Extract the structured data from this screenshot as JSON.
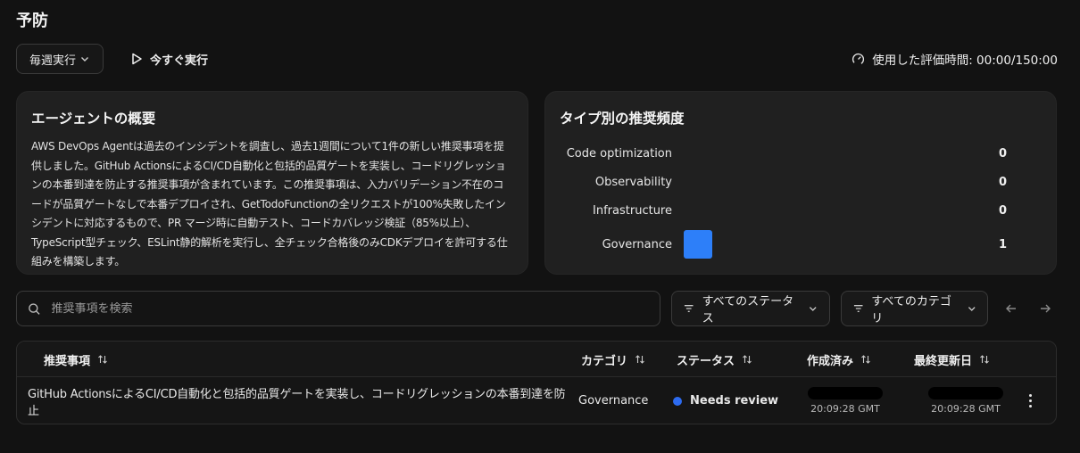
{
  "page": {
    "title": "予防"
  },
  "toolbar": {
    "schedule_label": "毎週実行",
    "run_now_label": "今すぐ実行",
    "eval_time_label": "使用した評価時間: 00:00/150:00"
  },
  "overview": {
    "title": "エージェントの概要",
    "text": "AWS DevOps Agentは過去のインシデントを調査し、過去1週間について1件の新しい推奨事項を提供しました。GitHub ActionsによるCI/CD自動化と包括的品質ゲートを実装し、コードリグレッションの本番到達を防止する推奨事項が含まれています。この推奨事項は、入力バリデーション不在のコードが品質ゲートなしで本番デプロイされ、GetTodoFunctionの全リクエストが100%失敗したインシデントに対応するもので、PR マージ時に自動テスト、コードカバレッジ検証（85%以上）、TypeScript型チェック、ESLint静的解析を実行し、全チェック合格後のみCDKデプロイを許可する仕組みを構築します。"
  },
  "frequency": {
    "title": "タイプ別の推奨頻度",
    "bar_color": "#2d7ff9",
    "max": 1,
    "rows": [
      {
        "label": "Code optimization",
        "count": "0",
        "value": 0
      },
      {
        "label": "Observability",
        "count": "0",
        "value": 0
      },
      {
        "label": "Infrastructure",
        "count": "0",
        "value": 0
      },
      {
        "label": "Governance",
        "count": "1",
        "value": 1
      }
    ]
  },
  "filters": {
    "search_placeholder": "推奨事項を検索",
    "status_label": "すべてのステータス",
    "category_label": "すべてのカテゴリ"
  },
  "table": {
    "headers": {
      "recommendation": "推奨事項",
      "category": "カテゴリ",
      "status": "ステータス",
      "created": "作成済み",
      "updated": "最終更新日"
    },
    "rows": [
      {
        "recommendation": "GitHub ActionsによるCI/CD自動化と包括的品質ゲートを実装し、コードリグレッションの本番到達を防止",
        "category": "Governance",
        "status": "Needs review",
        "status_color": "#2d6bf0",
        "created_time": "20:09:28 GMT",
        "updated_time": "20:09:28 GMT"
      }
    ]
  }
}
